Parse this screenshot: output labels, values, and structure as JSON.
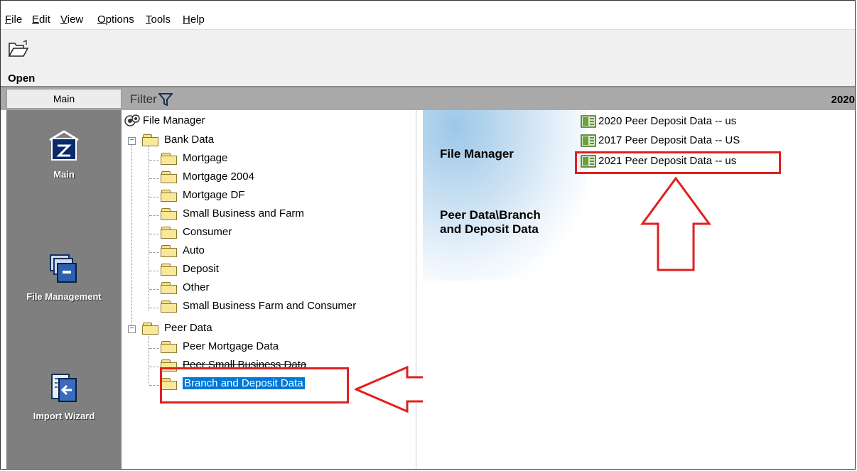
{
  "menu": [
    "File",
    "Edit",
    "View",
    "Options",
    "Tools",
    "Help"
  ],
  "toolbar": {
    "open_label": "Open",
    "icon": "open-folder-icon"
  },
  "tabs": {
    "main_label": "Main",
    "filter_label": "Filter",
    "year_label": "2020"
  },
  "sidebar": {
    "items": [
      {
        "label": "Main",
        "icon": "home-z-icon"
      },
      {
        "label": "File Management",
        "icon": "file-cabinet-icon"
      },
      {
        "label": "Import Wizard",
        "icon": "import-wizard-icon"
      }
    ]
  },
  "tree": {
    "root": "File Manager",
    "bank_data": {
      "label": "Bank Data",
      "children": [
        "Mortgage",
        "Mortgage 2004",
        "Mortgage DF",
        "Small Business and Farm",
        "Consumer",
        "Auto",
        "Deposit",
        "Other",
        "Small Business Farm and Consumer"
      ]
    },
    "peer_data": {
      "label": "Peer Data",
      "children": [
        "Peer Mortgage Data",
        "Peer Small Business Data",
        "Branch and Deposit Data"
      ]
    }
  },
  "content": {
    "title": "File Manager",
    "path": "Peer Data\\Branch and Deposit Data",
    "files": [
      "2020 Peer Deposit Data -- us",
      "2017 Peer Deposit Data -- US",
      "2021 Peer Deposit Data -- us"
    ]
  },
  "colors": {
    "highlight": "#e02020",
    "selection": "#0078d7",
    "sidebar": "#7f7f7f"
  }
}
